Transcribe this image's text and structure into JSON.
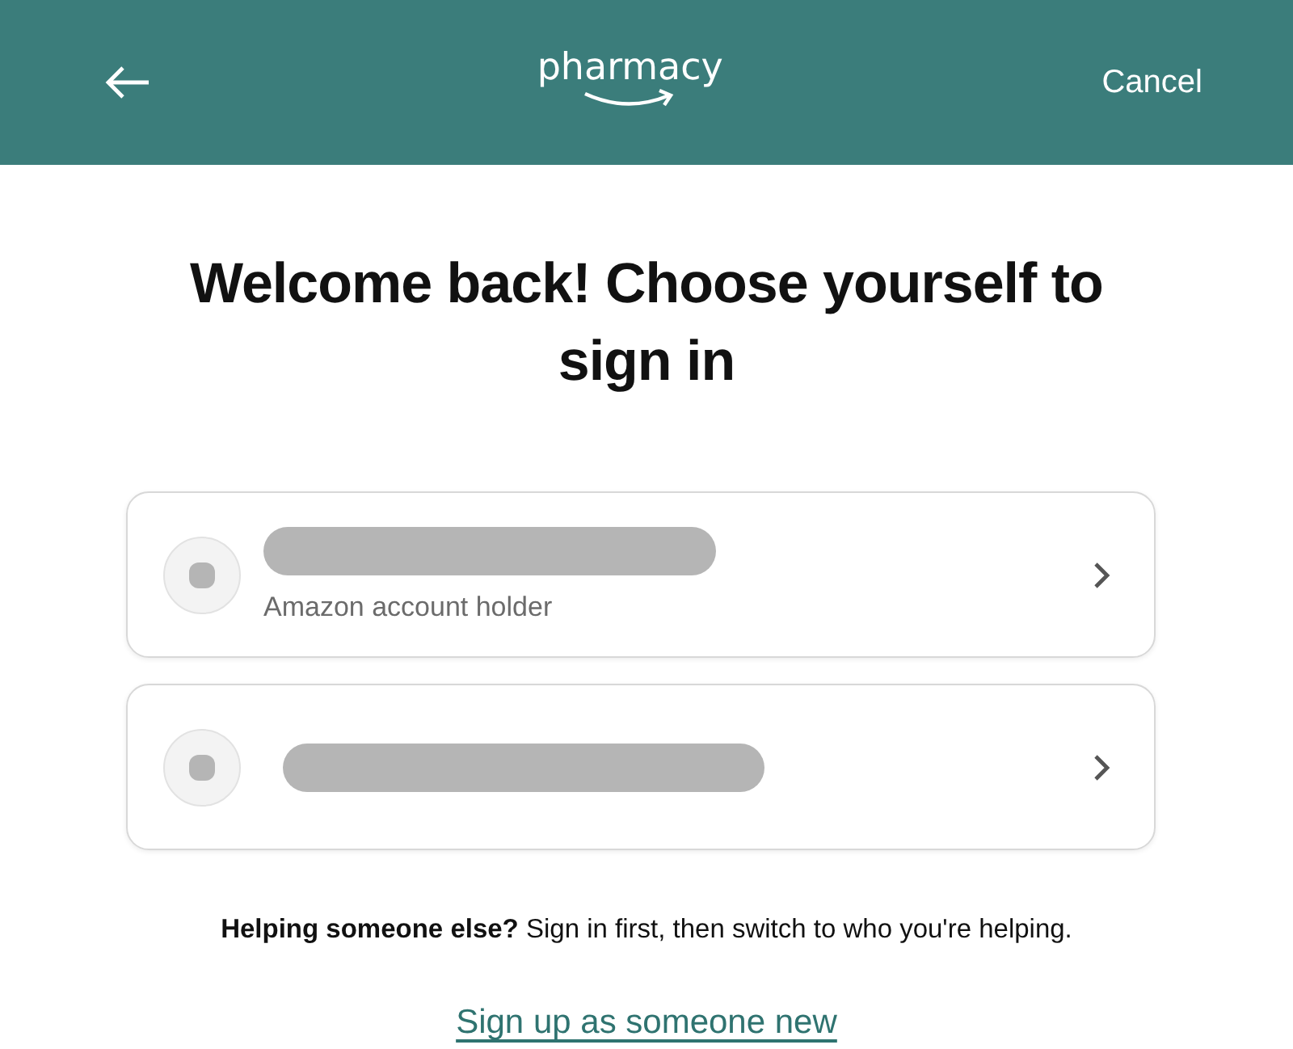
{
  "header": {
    "logo_text": "pharmacy",
    "cancel": "Cancel"
  },
  "title": "Welcome back! Choose yourself to sign in",
  "profiles": [
    {
      "name_redacted": true,
      "subtitle": "Amazon account holder"
    },
    {
      "name_redacted": true
    }
  ],
  "helper_text": "**Helping someone else?** Sign in first, then switch to who you're helping.",
  "signup_link": "Sign up as someone new"
}
